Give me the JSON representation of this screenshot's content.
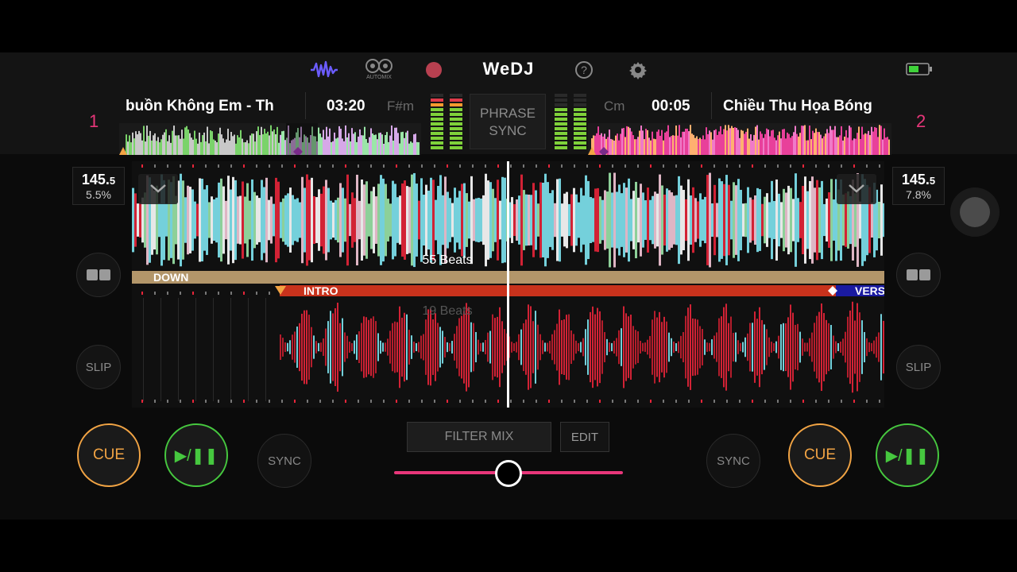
{
  "header": {
    "logo": "WeDJ",
    "automix_label": "AUTOMIX",
    "help_icon": "?"
  },
  "deck1": {
    "number": "1",
    "title": "buồn Không Em - Th",
    "time": "03:20",
    "key": "F#m",
    "bpm_int": "145.",
    "bpm_dec": "5",
    "pitch": "5.5%",
    "beats_top": "55 Beats",
    "phrase_top": "DOWN",
    "cue_label": "CUE",
    "play_label": "▶/❚❚",
    "slip_label": "SLIP",
    "sync_label": "SYNC"
  },
  "deck2": {
    "number": "2",
    "title": "Chiều Thu Họa Bóng",
    "time": "00:05",
    "key": "Cm",
    "bpm_int": "145.",
    "bpm_dec": "5",
    "pitch": "7.8%",
    "beats_bottom": "19 Beats",
    "phrase_intro": "INTRO",
    "phrase_verse": "VERS",
    "cue_label": "CUE",
    "play_label": "▶/❚❚",
    "slip_label": "SLIP",
    "sync_label": "SYNC"
  },
  "center": {
    "phrase_sync_line1": "PHRASE",
    "phrase_sync_line2": "SYNC",
    "filter_mix": "FILTER MIX",
    "edit": "EDIT",
    "crossfader_position": 0.5
  },
  "colors": {
    "accent": "#e8367a",
    "cue": "#f2a444",
    "play": "#46c83f",
    "wave_cyan": "#7fe6f2",
    "wave_red": "#e8253a"
  }
}
